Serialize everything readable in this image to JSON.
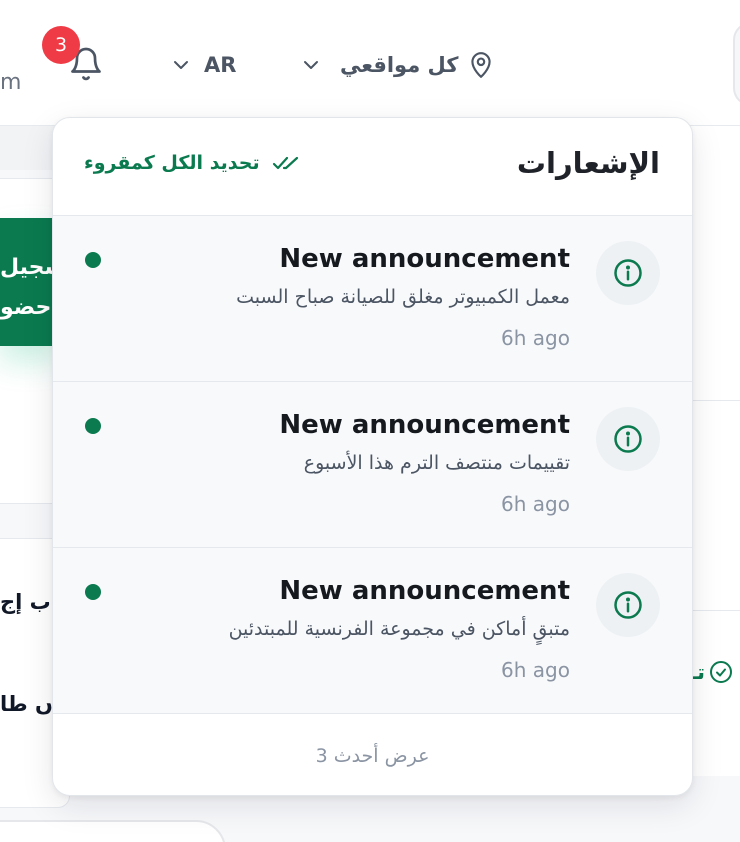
{
  "header": {
    "left_partial_text": "m",
    "notifications_badge": "3",
    "language": "AR",
    "location_filter": "كل مواقعي",
    "icons": [
      "bell-icon",
      "chevron-down-icon",
      "map-pin-icon"
    ]
  },
  "background": {
    "green_card_lines": [
      "سجيل",
      "حضو"
    ],
    "list_lines": [
      "ب إج",
      "ں طا"
    ],
    "right_check_text": "تـ"
  },
  "notifications_panel": {
    "title": "الإشعارات",
    "mark_all_read": "تحديد الكل كمقروء",
    "items": [
      {
        "title": "New announcement",
        "body": "معمل الكمبيوتر مغلق للصيانة صباح السبت",
        "time": "6h ago",
        "unread": true,
        "icon": "info-icon"
      },
      {
        "title": "New announcement",
        "body": "تقييمات منتصف الترم هذا الأسبوع",
        "time": "6h ago",
        "unread": true,
        "icon": "info-icon"
      },
      {
        "title": "New announcement",
        "body": "متبقٍ أماكن في مجموعة الفرنسية للمبتدئين",
        "time": "6h ago",
        "unread": true,
        "icon": "info-icon"
      }
    ],
    "view_latest": "عرض أحدث 3"
  },
  "colors": {
    "accent_green": "#0b7a4f",
    "badge_red": "#ef3b45",
    "muted_text": "#8a94a3"
  }
}
